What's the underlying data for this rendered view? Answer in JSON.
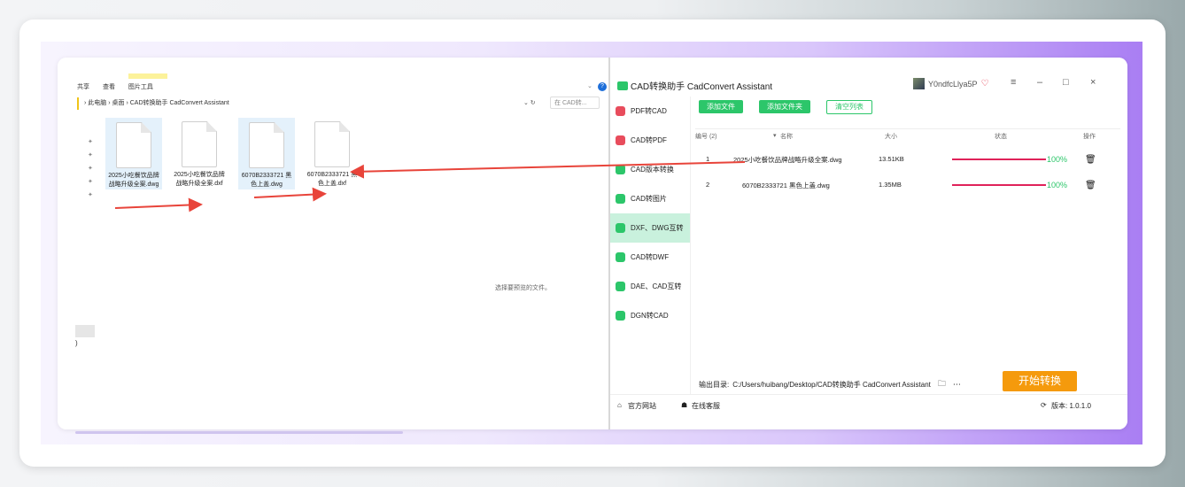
{
  "explorer": {
    "ribbon": [
      "共享",
      "查看",
      "图片工具"
    ],
    "address": "› 此电脑 › 桌面 › CAD转换助手 CadConvert Assistant",
    "search_placeholder": "在 CAD转...",
    "files": [
      {
        "name": "2025小吃餐饮品牌战略升级全案.dwg",
        "selected": true
      },
      {
        "name": "2025小吃餐饮品牌战略升级全案.dxf",
        "selected": false
      },
      {
        "name": "6070B2333721 黑色上盖.dwg",
        "selected": true
      },
      {
        "name": "6070B2333721 黑色上盖.dxf",
        "selected": false
      }
    ],
    "preview_text": "选择要预览的文件。",
    "paren": ")"
  },
  "app": {
    "title": "CAD转换助手 CadConvert Assistant",
    "username": "Y0ndfcLlya5P",
    "sidebar": [
      {
        "label": "PDF转CAD",
        "icon": "pdf-icon",
        "color": "#e84c5c"
      },
      {
        "label": "CAD转PDF",
        "icon": "pdf-icon",
        "color": "#e84c5c"
      },
      {
        "label": "CAD版本转换",
        "icon": "cad-icon",
        "color": "#2cc66a"
      },
      {
        "label": "CAD转图片",
        "icon": "image-icon",
        "color": "#2cc66a"
      },
      {
        "label": "DXF、DWG互转",
        "icon": "dxf-icon",
        "color": "#2cc66a",
        "active": true
      },
      {
        "label": "CAD转DWF",
        "icon": "cad-icon",
        "color": "#2cc66a"
      },
      {
        "label": "DAE、CAD互转",
        "icon": "dae-icon",
        "color": "#2cc66a"
      },
      {
        "label": "DGN转CAD",
        "icon": "dgn-icon",
        "color": "#2cc66a"
      }
    ],
    "buttons": {
      "add_file": "添加文件",
      "add_folder": "添加文件夹",
      "clear_list": "清空列表"
    },
    "columns": {
      "index": "编号 (2)",
      "name": "名称",
      "size": "大小",
      "status": "状态",
      "action": "操作"
    },
    "rows": [
      {
        "index": "1",
        "name": "2025小吃餐饮品牌战略升级全案.dwg",
        "size": "13.51KB",
        "progress": "100%"
      },
      {
        "index": "2",
        "name": "6070B2333721 黑色上盖.dwg",
        "size": "1.35MB",
        "progress": "100%"
      }
    ],
    "output_label": "输出目录:",
    "output_path": "C:/Users/huibang/Desktop/CAD转换助手 CadConvert Assistant",
    "start_button": "开始转换",
    "footer": {
      "website": "官方网站",
      "support": "在线客服",
      "version": "版本: 1.0.1.0"
    },
    "colors": {
      "accent": "#2cc66a",
      "start": "#f59a0c",
      "progress": "#e0225a"
    }
  }
}
